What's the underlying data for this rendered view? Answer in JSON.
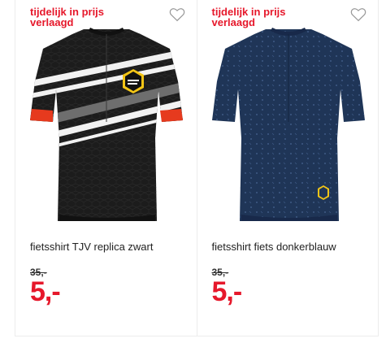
{
  "products": [
    {
      "promo_label": "tijdelijk in prijs verlaagd",
      "title": "fietsshirt TJV replica zwart",
      "old_price": "35,-",
      "new_price": "5,-",
      "color": "#1c1c1c",
      "icon": "heart-outline-icon"
    },
    {
      "promo_label": "tijdelijk in prijs verlaagd",
      "title": "fietsshirt fiets donkerblauw",
      "old_price": "35,-",
      "new_price": "5,-",
      "color": "#1f3557",
      "icon": "heart-outline-icon"
    }
  ]
}
